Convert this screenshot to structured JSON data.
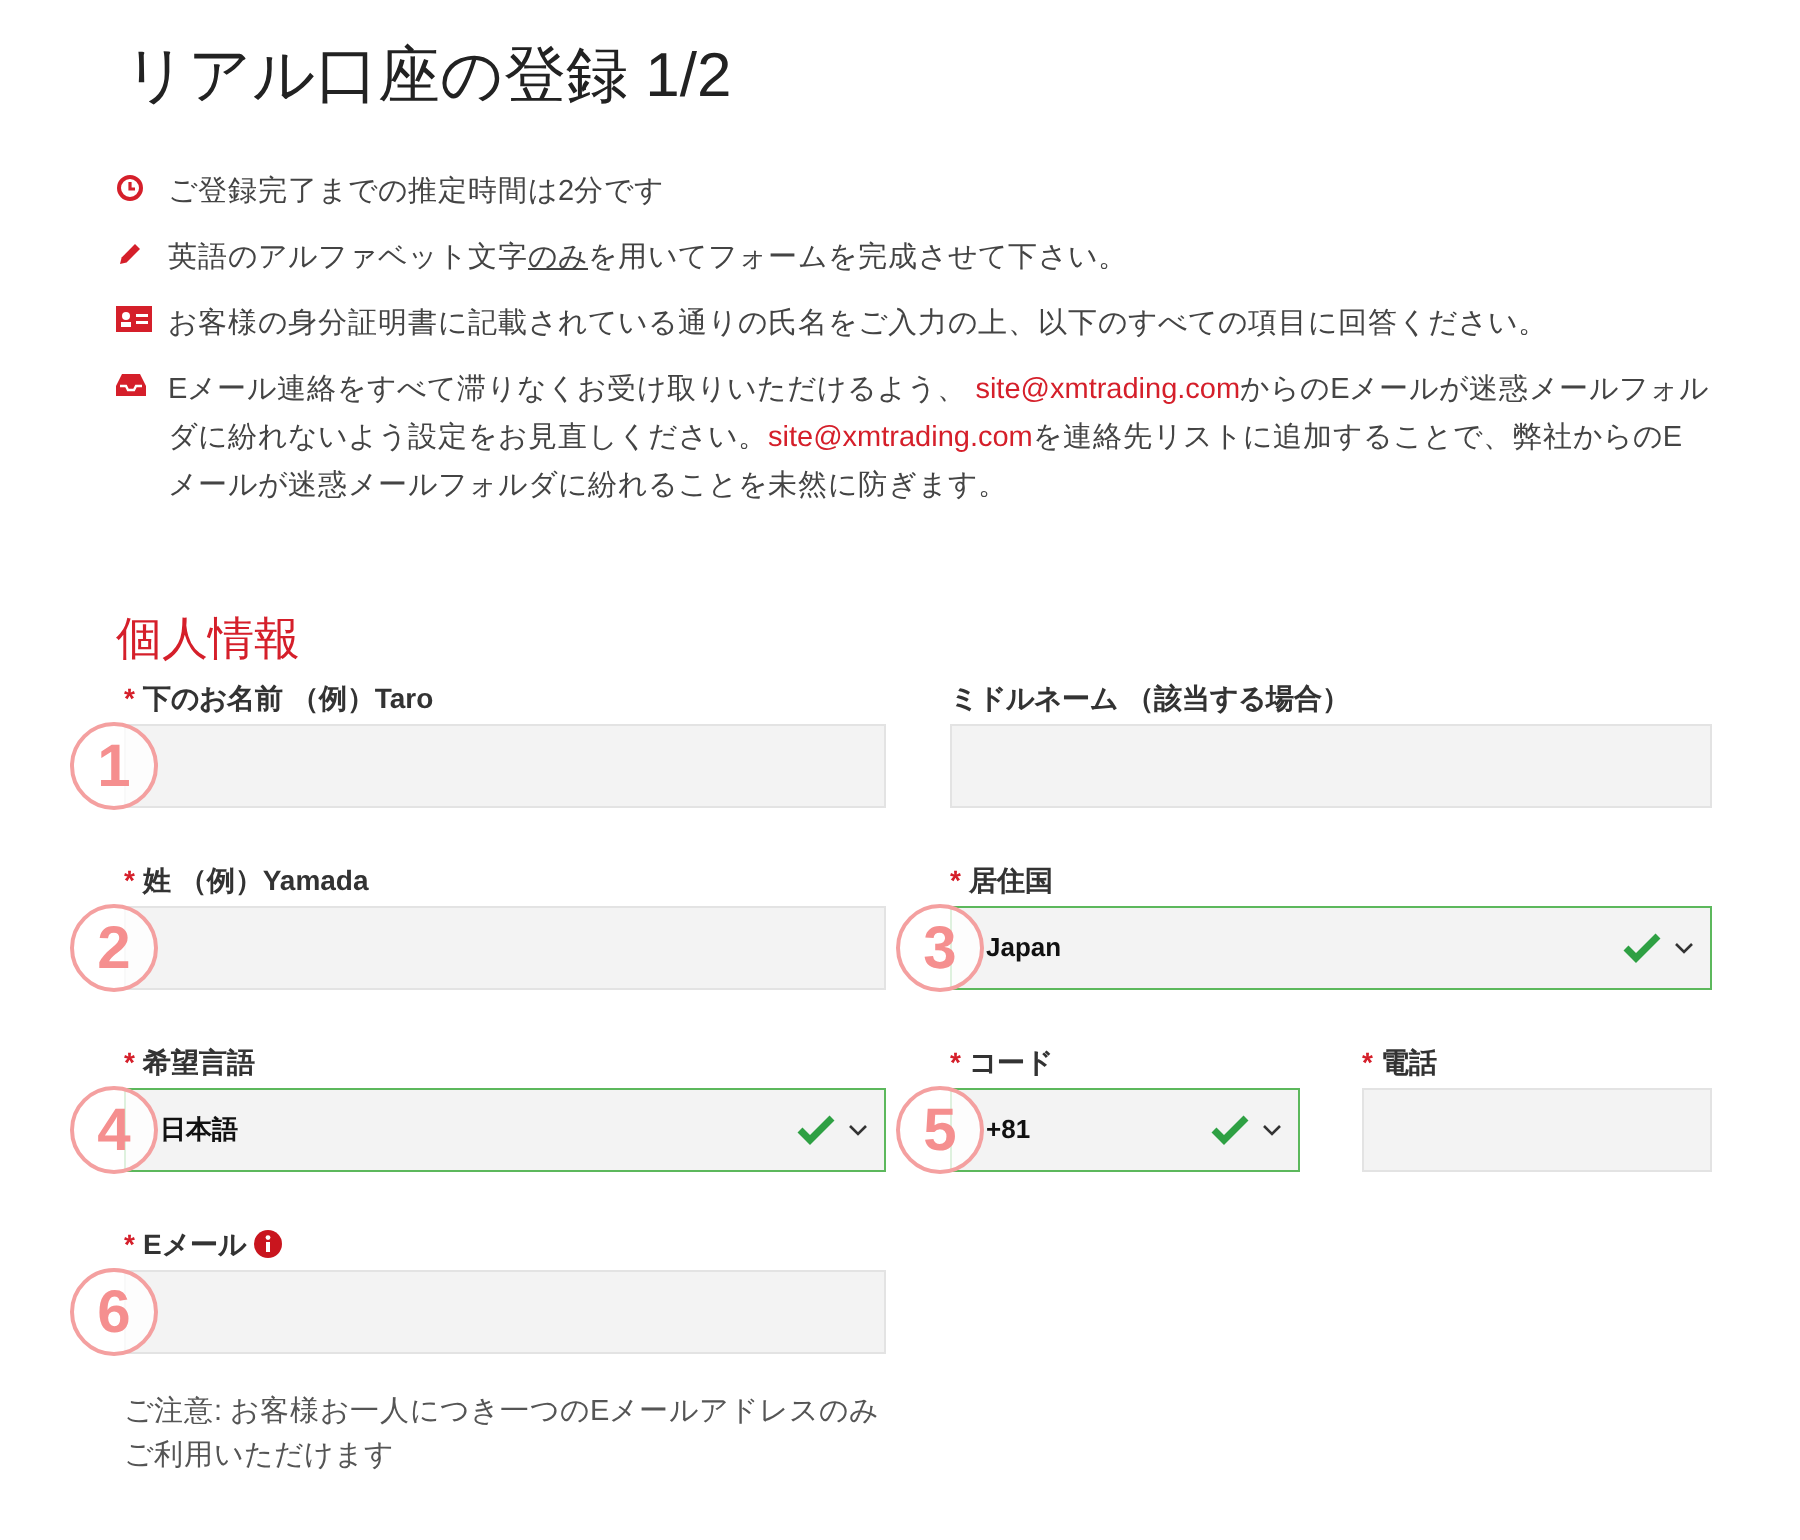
{
  "title": "リアル口座の登録 1/2",
  "notices": [
    {
      "parts": [
        {
          "kind": "text",
          "text": "ご登録完了までの推定時間は2分です"
        }
      ]
    },
    {
      "parts": [
        {
          "kind": "text",
          "text": "英語のアルファベット文字"
        },
        {
          "kind": "underline",
          "text": "のみ"
        },
        {
          "kind": "text",
          "text": "を用いてフォームを完成させて下さい。"
        }
      ]
    },
    {
      "parts": [
        {
          "kind": "text",
          "text": "お客様の身分証明書に記載されている通りの氏名をご入力の上、以下のすべての項目に回答ください。"
        }
      ]
    },
    {
      "parts": [
        {
          "kind": "text",
          "text": "Eメール連絡をすべて滞りなくお受け取りいただけるよう、 "
        },
        {
          "kind": "link",
          "text": "site@xmtrading.com"
        },
        {
          "kind": "text",
          "text": "からのEメールが迷惑メールフォルダに紛れないよう設定をお見直しください。"
        },
        {
          "kind": "link",
          "text": "site@xmtrading.com"
        },
        {
          "kind": "text",
          "text": "を連絡先リストに追加することで、弊社からのEメールが迷惑メールフォルダに紛れることを未然に防ぎます。"
        }
      ]
    }
  ],
  "section_title": "個人情報",
  "rows": [
    [
      {
        "kind": "text",
        "label": "下のお名前 （例）Taro",
        "required": "*",
        "marker": "1"
      },
      {
        "kind": "text",
        "label": "ミドルネーム （該当する場合）"
      }
    ],
    [
      {
        "kind": "text",
        "label": "姓 （例）Yamada",
        "required": "*",
        "marker": "2"
      },
      {
        "kind": "select",
        "label": "居住国",
        "required": "*",
        "value": "Japan",
        "valid": true,
        "marker": "3"
      }
    ],
    [
      {
        "kind": "select",
        "label": "希望言語",
        "required": "*",
        "value": "日本語",
        "valid": true,
        "marker": "4"
      },
      {
        "kind": "pair",
        "items": [
          {
            "kind": "select",
            "label": "コード",
            "required": "*",
            "value": "+81",
            "valid": true,
            "marker": "5"
          },
          {
            "kind": "text",
            "label": "電話",
            "required": "*"
          }
        ]
      }
    ],
    [
      {
        "kind": "text",
        "label": "Eメール",
        "required": "*",
        "info": true,
        "marker": "6",
        "note": "ご注意: お客様お一人につき一つのEメールアドレスのみご利用いただけます"
      }
    ]
  ]
}
